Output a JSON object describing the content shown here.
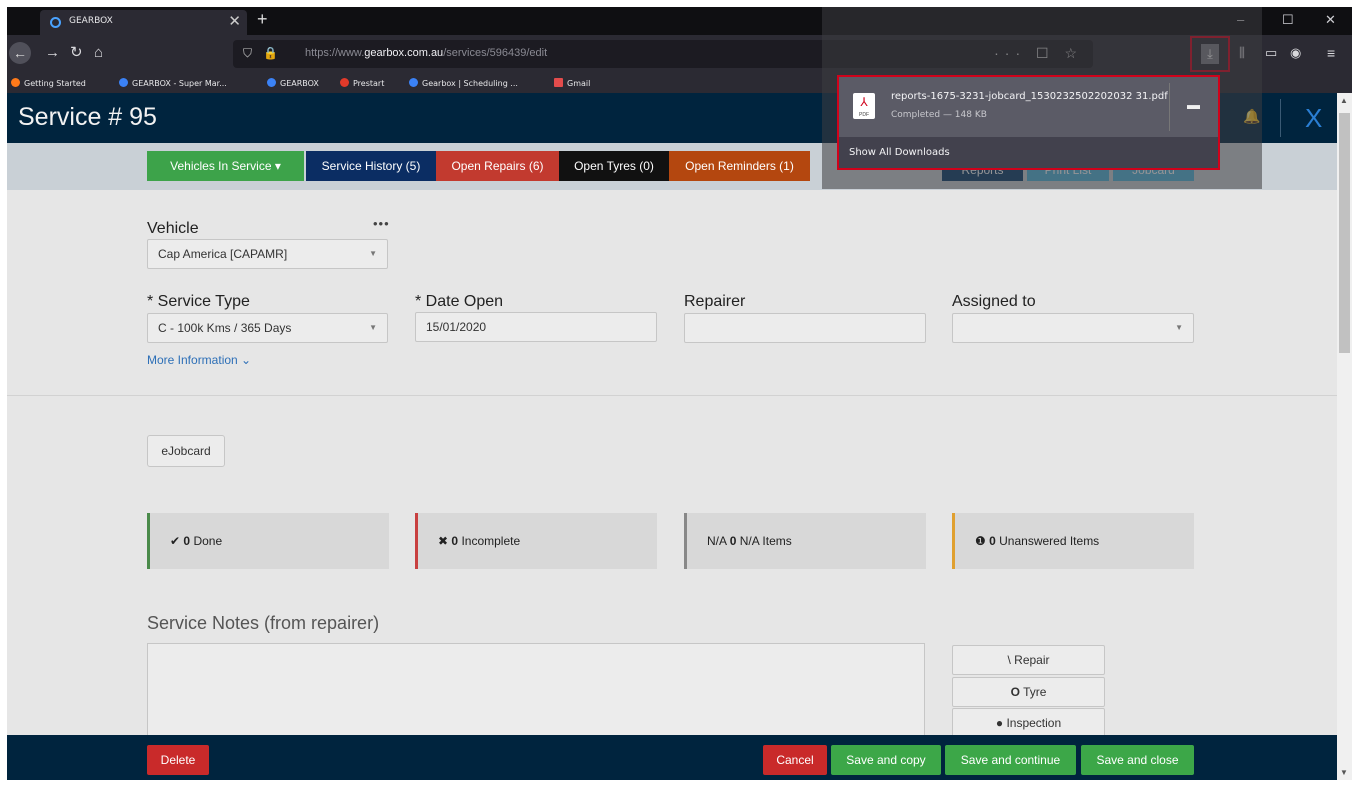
{
  "browser": {
    "tab_title": "GEARBOX",
    "tab_close": "✕",
    "new_tab": "+",
    "url_prefix": "https://www.",
    "url_domain": "gearbox.com.au",
    "url_path": "/services/596439/edit",
    "url_actions": "··· ☐ ☆",
    "window_controls": [
      "–",
      "☐",
      "✕"
    ],
    "bookmarks": [
      {
        "label": "Getting Started",
        "color": "#ff7a1a"
      },
      {
        "label": "GEARBOX - Super Mar...",
        "color": "#3b82f6"
      },
      {
        "label": "GEARBOX",
        "color": "#3b82f6"
      },
      {
        "label": "Prestart",
        "color": "#e23a2a"
      },
      {
        "label": "Gearbox | Scheduling ...",
        "color": "#3b82f6"
      },
      {
        "label": "Gmail",
        "color": "#e34c4c"
      }
    ]
  },
  "downloads": {
    "file_name": "reports-1675-3231-jobcard_1530232502202032 31.pdf",
    "status": "Completed — 148 KB",
    "icon_label": "PDF",
    "show_all": "Show All Downloads"
  },
  "page": {
    "title": "Service # 95",
    "header_close": "X",
    "nav_pills": [
      {
        "label": "Vehicles In Service  ▾",
        "color": "#3da34a"
      },
      {
        "label": "Service History (5)",
        "color": "#0b2d63"
      },
      {
        "label": "Open Repairs (6)",
        "color": "#c23a2f"
      },
      {
        "label": "Open Tyres (0)",
        "color": "#111111"
      },
      {
        "label": "Open Reminders (1)",
        "color": "#b4470f"
      }
    ],
    "toolbar_buttons": [
      {
        "label": "Reports",
        "color": "#0a3d6b"
      },
      {
        "label": "Print List",
        "color": "#4fb3d9"
      },
      {
        "label": "Jobcard",
        "color": "#4fb3d9"
      }
    ],
    "form": {
      "vehicle_label": "Vehicle",
      "vehicle_value": "Cap America [CAPAMR]",
      "vehicle_menu": "•••",
      "service_type_label": "* Service Type",
      "service_type_value": "C - 100k Kms / 365 Days",
      "date_open_label": "* Date Open",
      "date_open_value": "15/01/2020",
      "repairer_label": "Repairer",
      "repairer_value": "",
      "assigned_label": "Assigned to",
      "assigned_value": "",
      "more_info": "More Information"
    },
    "ejobcard_label": "eJobcard",
    "stats": [
      {
        "icon": "✔",
        "count": "0",
        "label": "Done",
        "color": "#4a8a4a"
      },
      {
        "icon": "✖",
        "count": "0",
        "label": "Incomplete",
        "color": "#c84040"
      },
      {
        "icon": "N/A",
        "count": "0",
        "label": "N/A Items",
        "color": "#888888"
      },
      {
        "icon": "❶",
        "count": "0",
        "label": "Unanswered Items",
        "color": "#e0a030"
      }
    ],
    "notes_title": "Service Notes (from repairer)",
    "side_buttons": [
      {
        "icon": "\\",
        "label": "Repair"
      },
      {
        "icon": "O",
        "label": "Tyre"
      },
      {
        "icon": "●",
        "label": "Inspection"
      }
    ],
    "footer": {
      "delete": "Delete",
      "cancel": "Cancel",
      "save_copy": "Save and copy",
      "save_continue": "Save and continue",
      "save_close": "Save and close"
    }
  }
}
